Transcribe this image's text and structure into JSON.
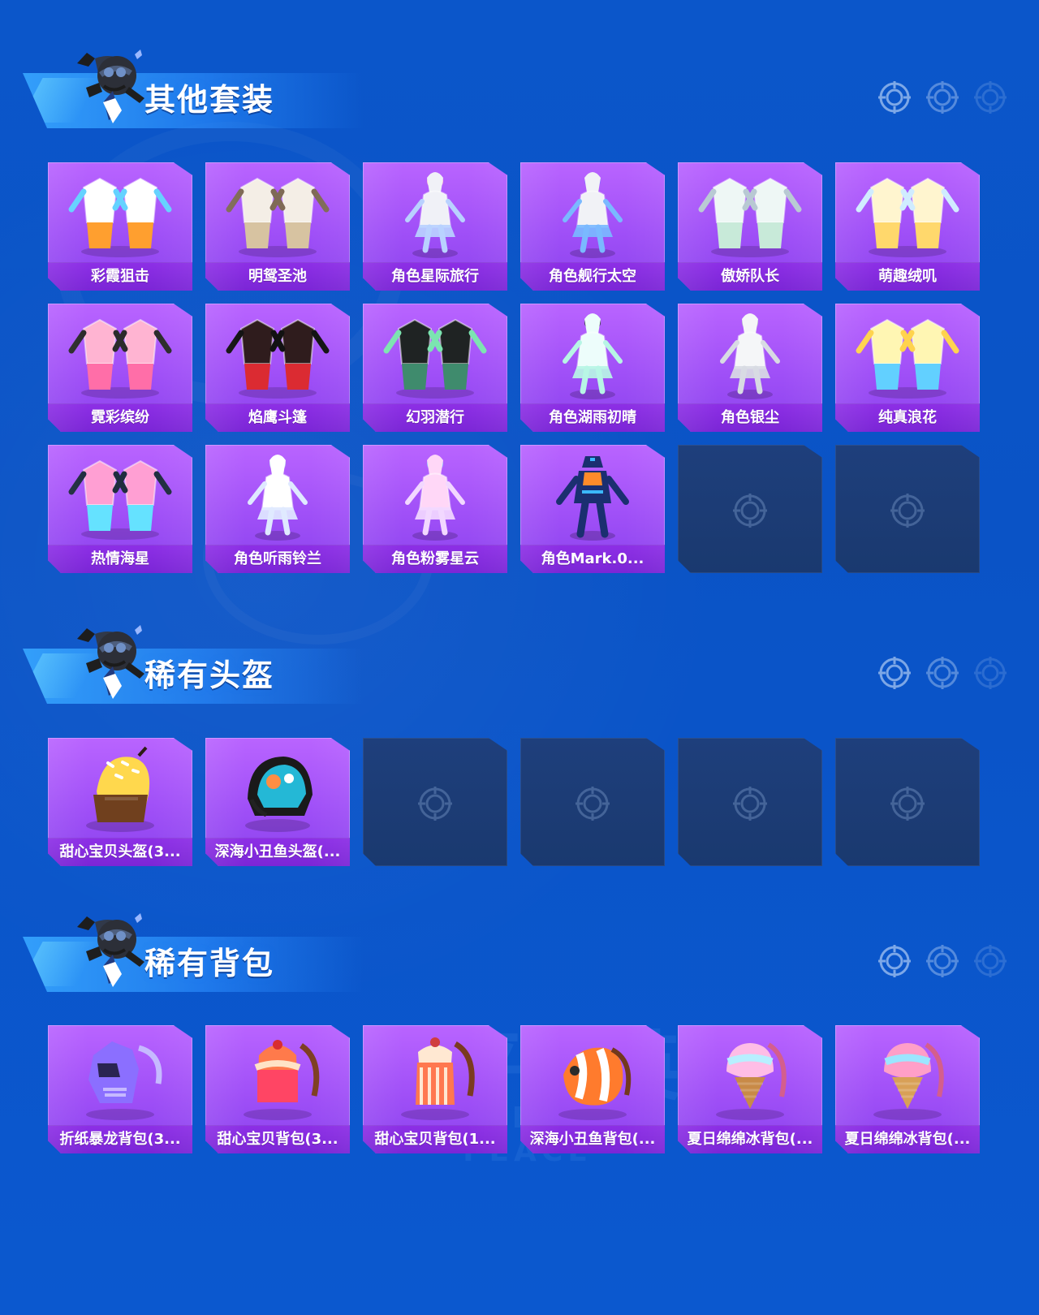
{
  "sections": [
    {
      "title": "其他套装",
      "items": [
        {
          "label": "彩霞狙击",
          "icon": "outfit-pair-icon",
          "palette": [
            "#ffffff",
            "#ff9f2f",
            "#64d2ff"
          ]
        },
        {
          "label": "明鸳圣池",
          "icon": "outfit-pair-icon",
          "palette": [
            "#f4eee6",
            "#d7c3a1",
            "#7f6a56"
          ]
        },
        {
          "label": "角色星际旅行",
          "icon": "character-figure-icon",
          "palette": [
            "#f0f1f7",
            "#b9d1ff",
            "#ffc6d9"
          ]
        },
        {
          "label": "角色舰行太空",
          "icon": "character-figure-icon",
          "palette": [
            "#f1f2f6",
            "#7ab9ff",
            "#8e61ff"
          ]
        },
        {
          "label": "傲娇队长",
          "icon": "outfit-pair-icon",
          "palette": [
            "#eef7f5",
            "#c8ead9",
            "#b8c9d3"
          ]
        },
        {
          "label": "萌趣绒叽",
          "icon": "outfit-pair-icon",
          "palette": [
            "#fff5cf",
            "#ffd86c",
            "#d0ecff"
          ]
        },
        {
          "label": "霓彩缤纷",
          "icon": "outfit-pair-icon",
          "palette": [
            "#ffb4d2",
            "#ff6ea8",
            "#2b2b2b"
          ]
        },
        {
          "label": "焰鹰斗篷",
          "icon": "outfit-pair-icon",
          "palette": [
            "#2f1c1d",
            "#db2b32",
            "#121212"
          ]
        },
        {
          "label": "幻羽潜行",
          "icon": "outfit-pair-icon",
          "palette": [
            "#1f2323",
            "#3f8b6d",
            "#7be4b0"
          ]
        },
        {
          "label": "角色湖雨初晴",
          "icon": "character-figure-icon",
          "palette": [
            "#edfdfb",
            "#b7f5e5",
            "#2a2f3d"
          ]
        },
        {
          "label": "角色银尘",
          "icon": "character-figure-icon",
          "palette": [
            "#f5f6f8",
            "#d8dbe3",
            "#b5bbc8"
          ]
        },
        {
          "label": "纯真浪花",
          "icon": "outfit-pair-icon",
          "palette": [
            "#fff6b3",
            "#62d0ff",
            "#ffd34d"
          ]
        },
        {
          "label": "热情海星",
          "icon": "outfit-pair-icon",
          "palette": [
            "#ff9fd3",
            "#65e2ff",
            "#1f2d3f"
          ]
        },
        {
          "label": "角色听雨铃兰",
          "icon": "character-figure-icon",
          "palette": [
            "#ffffff",
            "#dfe9ff",
            "#b5c5ef"
          ]
        },
        {
          "label": "角色粉雾星云",
          "icon": "character-figure-icon",
          "palette": [
            "#ffd7f7",
            "#f2d8ff",
            "#8cc6ff"
          ]
        },
        {
          "label": "角色Mark.0...",
          "icon": "mech-suit-icon",
          "palette": [
            "#1b2f70",
            "#ff8b2a",
            "#3bb8ff"
          ]
        },
        {
          "empty": true
        },
        {
          "empty": true
        }
      ]
    },
    {
      "title": "稀有头盔",
      "items": [
        {
          "label": "甜心宝贝头盔(3...",
          "icon": "cupcake-helmet-icon",
          "palette": [
            "#ffd84d",
            "#70401e",
            "#ffffff"
          ]
        },
        {
          "label": "深海小丑鱼头盔(...",
          "icon": "clownfish-helmet-icon",
          "palette": [
            "#24b8d6",
            "#1a1a1a",
            "#ff8e43"
          ]
        },
        {
          "empty": true
        },
        {
          "empty": true
        },
        {
          "empty": true
        },
        {
          "empty": true
        }
      ]
    },
    {
      "title": "稀有背包",
      "items": [
        {
          "label": "折纸暴龙背包(3...",
          "icon": "paper-dino-backpack-icon",
          "palette": [
            "#8b6fff",
            "#c6b9ff",
            "#2a2452"
          ]
        },
        {
          "label": "甜心宝贝背包(3...",
          "icon": "cake-backpack-icon",
          "palette": [
            "#ff7a4b",
            "#ff4564",
            "#ffe3c6"
          ]
        },
        {
          "label": "甜心宝贝背包(1...",
          "icon": "dessert-backpack-icon",
          "palette": [
            "#ff784f",
            "#ffe8d2",
            "#d03d3d"
          ]
        },
        {
          "label": "深海小丑鱼背包(...",
          "icon": "clownfish-backpack-icon",
          "palette": [
            "#ff7b2d",
            "#ffffff",
            "#2b2b2b"
          ]
        },
        {
          "label": "夏日绵绵冰背包(...",
          "icon": "ice-cream-backpack-icon",
          "palette": [
            "#ffbde6",
            "#b8efff",
            "#c88a47"
          ]
        },
        {
          "label": "夏日绵绵冰背包(...",
          "icon": "ice-cream-backpack-icon",
          "palette": [
            "#ff9fc8",
            "#9ce6ff",
            "#d8a057"
          ]
        }
      ]
    }
  ]
}
